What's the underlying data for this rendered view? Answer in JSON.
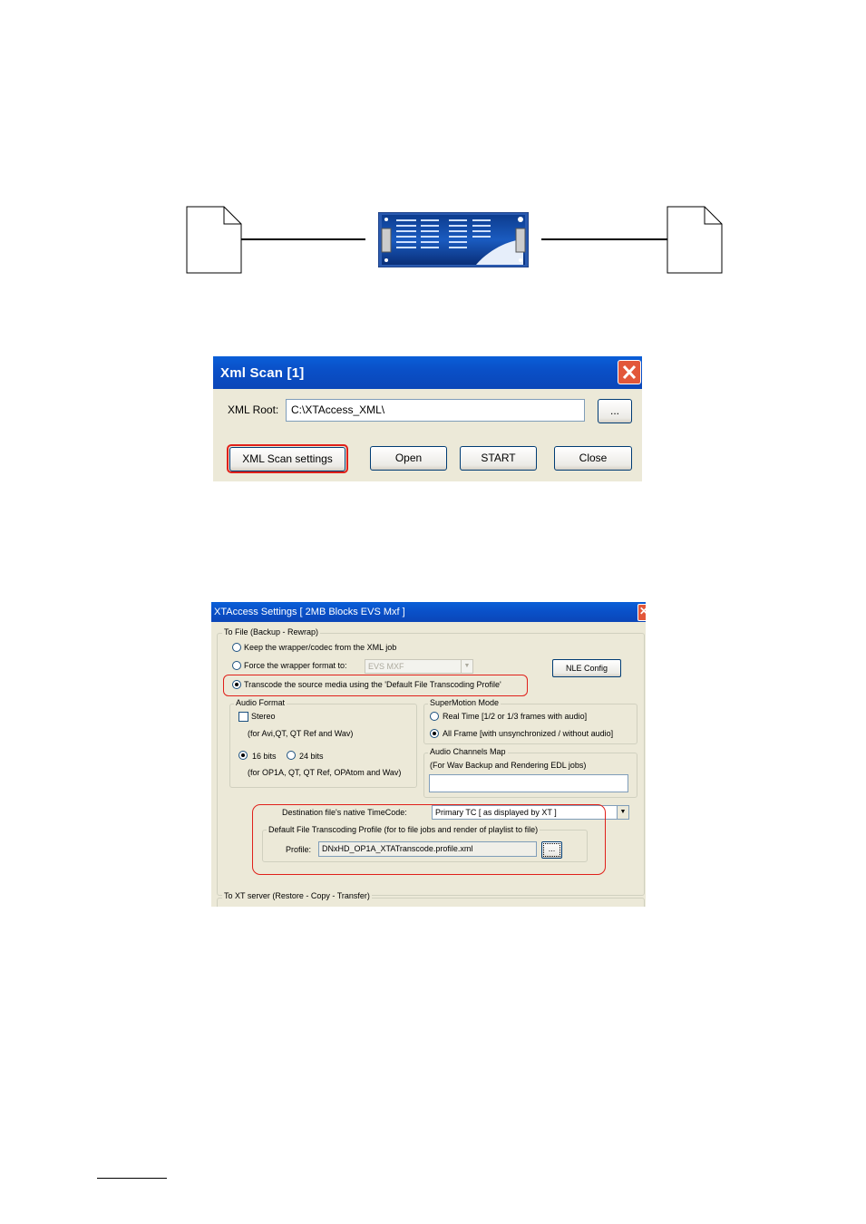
{
  "xml_scan_dialog": {
    "title": "Xml Scan [1]",
    "xml_root_label": "XML Root:",
    "xml_root_value": "C:\\XTAccess_XML\\",
    "browse_label": "...",
    "settings_label": "XML Scan settings",
    "open_label": "Open",
    "start_label": "START",
    "close_label": "Close"
  },
  "settings_dialog": {
    "title": "XTAccess Settings [ 2MB Blocks EVS Mxf ]",
    "to_file_group": "To File (Backup - Rewrap)",
    "keep_wrapper": "Keep the wrapper/codec from the XML job",
    "force_wrapper": "Force the wrapper format to:",
    "force_wrapper_value": "EVS MXF",
    "transcode": "Transcode the source media using the 'Default File Transcoding Profile'",
    "nle_config": "NLE Config",
    "audio_format": {
      "legend": "Audio Format",
      "stereo": "Stereo",
      "stereo_note": "(for Avi,QT, QT Ref and Wav)",
      "bits16": "16 bits",
      "bits24": "24 bits",
      "bits_note": "(for OP1A, QT, QT Ref, OPAtom and Wav)"
    },
    "supermotion": {
      "legend": "SuperMotion Mode",
      "real_time": "Real Time [1/2 or 1/3 frames with audio]",
      "all_frame": "All Frame [with unsynchronized / without audio]"
    },
    "audio_channels": {
      "legend": "Audio Channels Map",
      "note": "(For Wav Backup and Rendering EDL jobs)",
      "value": ""
    },
    "timecode_label": "Destination file's native TimeCode:",
    "timecode_value": "Primary TC [ as displayed by XT ]",
    "profile_group": "Default File Transcoding Profile (for to file jobs and render of playlist to file)",
    "profile_label": "Profile:",
    "profile_value": "DNxHD_OP1A_XTATranscode.profile.xml",
    "profile_browse": "...",
    "to_xt_group": "To XT server (Restore - Copy - Transfer)"
  },
  "colors": {
    "highlight_ring": "#e0201a",
    "titlebar": "#0a50c8",
    "dialog_bg": "#ece9d8"
  }
}
